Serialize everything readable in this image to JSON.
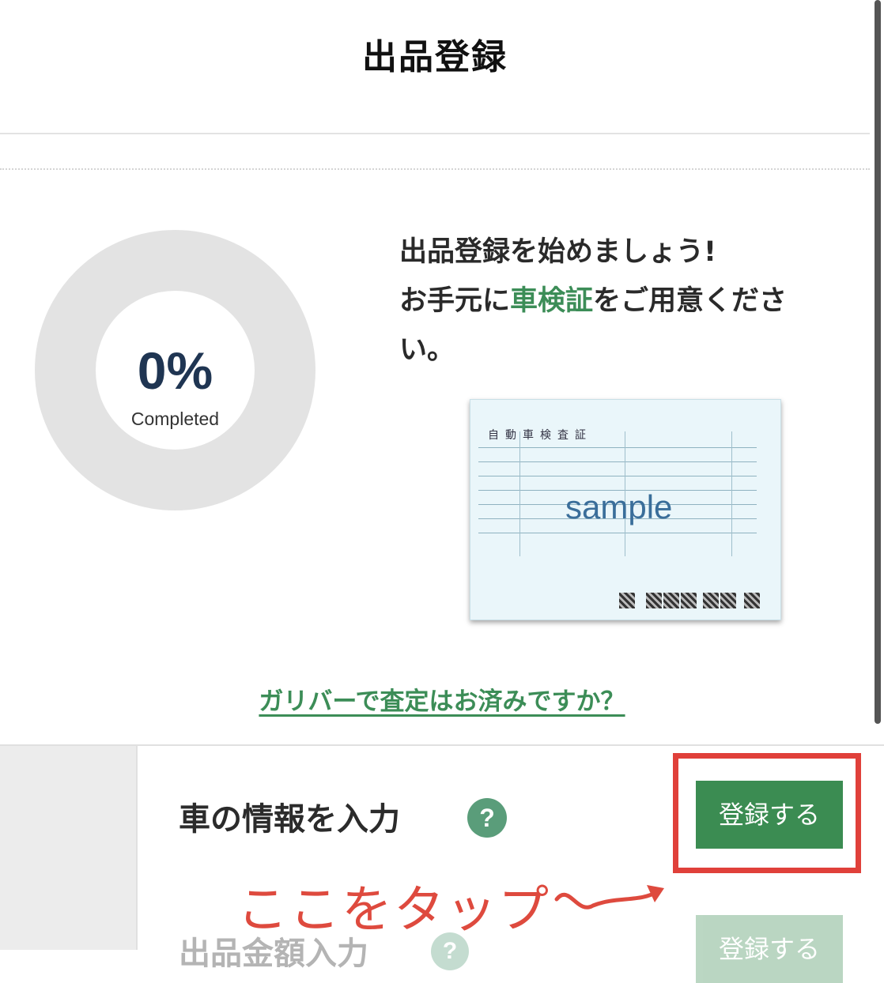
{
  "header": {
    "title": "出品登録"
  },
  "progress": {
    "percent_label": "0%",
    "value": 0,
    "caption": "Completed"
  },
  "intro": {
    "line1": "出品登録を始めましょう!",
    "line2_pre": "お手元に",
    "line2_highlight": "車検証",
    "line2_post": "をご用意くださ",
    "line3": "い。"
  },
  "certificate": {
    "title": "自動車検査証",
    "watermark": "sample"
  },
  "appraisal_link": "ガリバーで査定はお済みですか？",
  "steps": [
    {
      "label": "車の情報を入力",
      "help": "?",
      "button": "登録する",
      "enabled": true
    },
    {
      "label": "出品金額入力",
      "help": "?",
      "button": "登録する",
      "enabled": false
    }
  ],
  "annotation": {
    "text": "ここをタップ"
  },
  "colors": {
    "accent_green": "#3b8c52",
    "highlight_red": "#e0403a",
    "progress_track": "#e3e3e3",
    "progress_text": "#1f3552"
  }
}
